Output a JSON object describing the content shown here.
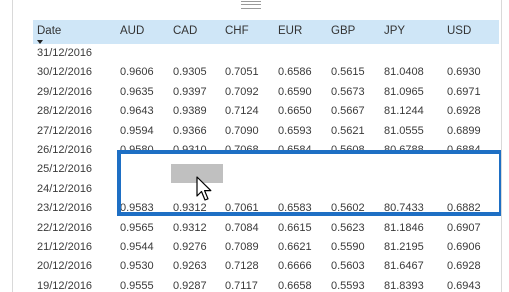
{
  "table": {
    "columns": [
      "Date",
      "AUD",
      "CAD",
      "CHF",
      "EUR",
      "GBP",
      "JPY",
      "USD"
    ],
    "rows": [
      {
        "date": "31/12/2016",
        "aud": "",
        "cad": "",
        "chf": "",
        "eur": "",
        "gbp": "",
        "jpy": "",
        "usd": ""
      },
      {
        "date": "30/12/2016",
        "aud": "0.9606",
        "cad": "0.9305",
        "chf": "0.7051",
        "eur": "0.6586",
        "gbp": "0.5615",
        "jpy": "81.0408",
        "usd": "0.6930"
      },
      {
        "date": "29/12/2016",
        "aud": "0.9635",
        "cad": "0.9397",
        "chf": "0.7092",
        "eur": "0.6590",
        "gbp": "0.5673",
        "jpy": "81.0965",
        "usd": "0.6971"
      },
      {
        "date": "28/12/2016",
        "aud": "0.9643",
        "cad": "0.9389",
        "chf": "0.7124",
        "eur": "0.6650",
        "gbp": "0.5667",
        "jpy": "81.1244",
        "usd": "0.6928"
      },
      {
        "date": "27/12/2016",
        "aud": "0.9594",
        "cad": "0.9366",
        "chf": "0.7090",
        "eur": "0.6593",
        "gbp": "0.5621",
        "jpy": "81.0555",
        "usd": "0.6899"
      },
      {
        "date": "26/12/2016",
        "aud": "0.9580",
        "cad": "0.9310",
        "chf": "0.7068",
        "eur": "0.6584",
        "gbp": "0.5608",
        "jpy": "80.6788",
        "usd": "0.6884"
      },
      {
        "date": "25/12/2016",
        "aud": "",
        "cad": "",
        "chf": "",
        "eur": "",
        "gbp": "",
        "jpy": "",
        "usd": ""
      },
      {
        "date": "24/12/2016",
        "aud": "",
        "cad": "",
        "chf": "",
        "eur": "",
        "gbp": "",
        "jpy": "",
        "usd": ""
      },
      {
        "date": "23/12/2016",
        "aud": "0.9583",
        "cad": "0.9312",
        "chf": "0.7061",
        "eur": "0.6583",
        "gbp": "0.5602",
        "jpy": "80.7433",
        "usd": "0.6882"
      },
      {
        "date": "22/12/2016",
        "aud": "0.9565",
        "cad": "0.9312",
        "chf": "0.7084",
        "eur": "0.6615",
        "gbp": "0.5623",
        "jpy": "81.1846",
        "usd": "0.6907"
      },
      {
        "date": "21/12/2016",
        "aud": "0.9544",
        "cad": "0.9276",
        "chf": "0.7089",
        "eur": "0.6621",
        "gbp": "0.5590",
        "jpy": "81.2195",
        "usd": "0.6906"
      },
      {
        "date": "20/12/2016",
        "aud": "0.9530",
        "cad": "0.9263",
        "chf": "0.7128",
        "eur": "0.6666",
        "gbp": "0.5603",
        "jpy": "81.6467",
        "usd": "0.6928"
      },
      {
        "date": "19/12/2016",
        "aud": "0.9555",
        "cad": "0.9287",
        "chf": "0.7117",
        "eur": "0.6658",
        "gbp": "0.5593",
        "jpy": "81.8393",
        "usd": "0.6943"
      }
    ]
  },
  "sort": {
    "column": "Date",
    "direction": "descending",
    "icon": "sort-descending-icon"
  },
  "colors": {
    "header_bg": "#cfe6f7",
    "highlight_border": "#1e6fc4",
    "drag_ghost": "#b9b9b9"
  },
  "cursor": {
    "icon": "pointer-cursor-icon"
  }
}
